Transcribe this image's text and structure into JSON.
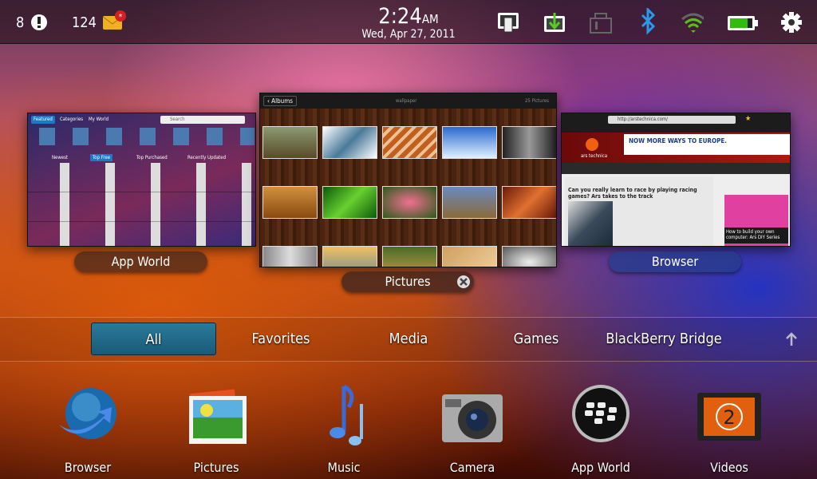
{
  "status": {
    "alerts_count": "8",
    "messages_count": "124",
    "time": "2:24",
    "ampm": "AM",
    "date": "Wed, Apr 27, 2011",
    "icons": [
      "alert-icon",
      "mail-icon",
      "bridge-icon",
      "download-icon",
      "orientation-lock-icon",
      "bluetooth-icon",
      "wifi-icon",
      "battery-icon",
      "settings-icon"
    ],
    "battery_level_percent": 75
  },
  "running_apps": [
    {
      "label": "App World",
      "tabs": [
        "Featured",
        "Categories",
        "My World"
      ],
      "search_placeholder": "Search",
      "sections": [
        "Newest",
        "Top Free",
        "Top Purchased",
        "Recently Updated"
      ]
    },
    {
      "label": "Pictures",
      "back": "Albums",
      "album": "wallpaper",
      "count": "25 Pictures"
    },
    {
      "label": "Browser",
      "url": "http://arstechnica.com/",
      "site": "ars technica",
      "ad": "NOW MORE WAYS TO EUROPE.",
      "headline": "Can you really learn to race by playing racing games? Ars takes to the track",
      "side": "How to build your own computer: Ars DIY Series"
    }
  ],
  "nav": {
    "tabs": [
      "All",
      "Favorites",
      "Media",
      "Games",
      "BlackBerry Bridge"
    ],
    "selected": "All"
  },
  "dock": [
    {
      "label": "Browser"
    },
    {
      "label": "Pictures"
    },
    {
      "label": "Music"
    },
    {
      "label": "Camera"
    },
    {
      "label": "App World"
    },
    {
      "label": "Videos"
    }
  ],
  "colors": {
    "selected_tab": "#1e6a8a",
    "battery": "#33bb11",
    "bluetooth": "#2a9ae8",
    "wifi": "#5ac018",
    "download": "#44aa22"
  }
}
